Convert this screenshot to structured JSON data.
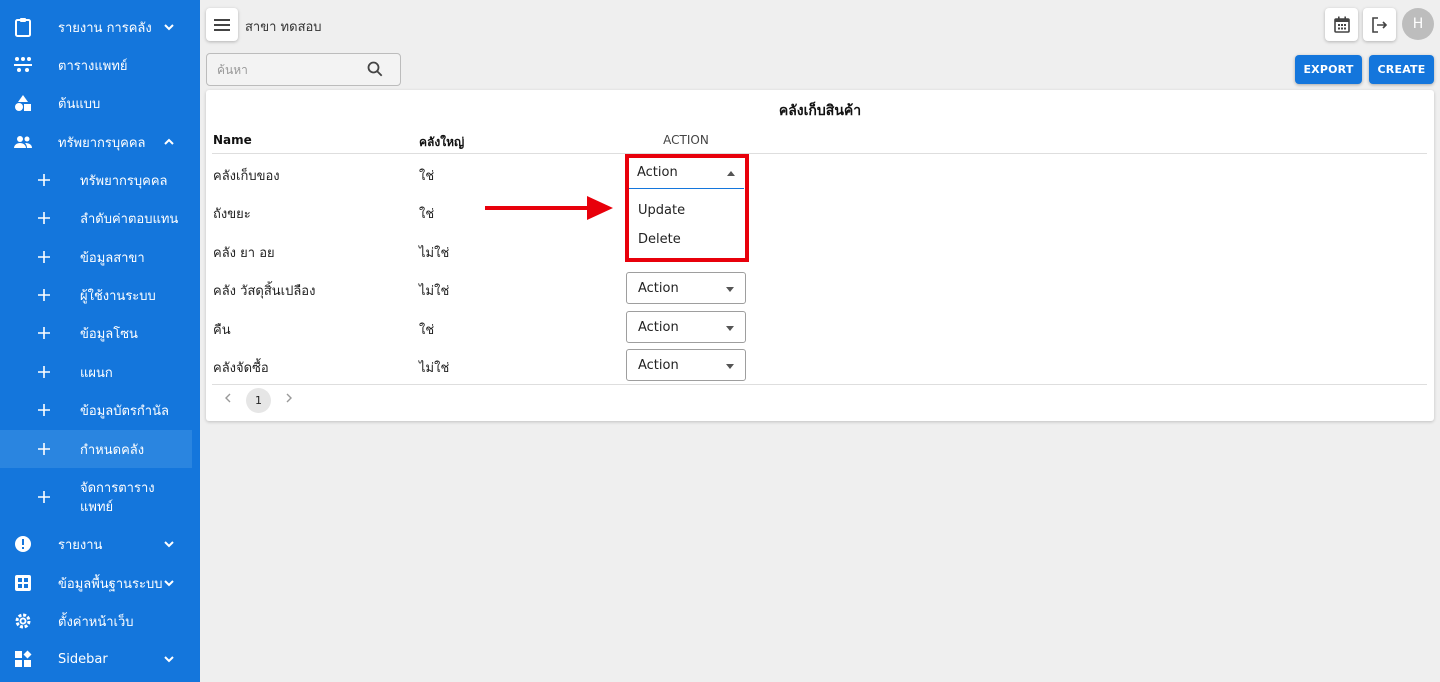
{
  "sidebar": {
    "items": [
      {
        "label": "รายงาน การคลัง",
        "icon": "clipboard-icon"
      },
      {
        "label": "ตารางแพทย์",
        "icon": "people-network-icon"
      },
      {
        "label": "ต้นแบบ",
        "icon": "shapes-icon"
      },
      {
        "label": "ทรัพยากรบุคคล",
        "icon": "group-icon"
      },
      {
        "label": "ทรัพยากรบุคคล",
        "icon": "plus-icon"
      },
      {
        "label": "ลำดับค่าตอบแทน",
        "icon": "plus-icon"
      },
      {
        "label": "ข้อมูลสาขา",
        "icon": "plus-icon"
      },
      {
        "label": "ผู้ใช้งานระบบ",
        "icon": "plus-icon"
      },
      {
        "label": "ข้อมูลโซน",
        "icon": "plus-icon"
      },
      {
        "label": "แผนก",
        "icon": "plus-icon"
      },
      {
        "label": "ข้อมูลบัตรกำนัล",
        "icon": "plus-icon"
      },
      {
        "label": "กำหนดคลัง",
        "icon": "plus-icon"
      },
      {
        "label_line1": "จัดการตาราง",
        "label_line2": "แพทย์",
        "icon": "plus-icon"
      },
      {
        "label": "รายงาน",
        "icon": "alert-circle-icon"
      },
      {
        "label": "ข้อมูลพื้นฐานระบบ",
        "icon": "grid-icon"
      },
      {
        "label": "ตั้งค่าหน้าเว็บ",
        "icon": "gear-icon"
      },
      {
        "label": "Sidebar",
        "icon": "widgets-icon"
      }
    ]
  },
  "header": {
    "branch": "สาขา ทดสอบ",
    "avatar_initial": "H"
  },
  "search": {
    "placeholder": "ค้นหา"
  },
  "buttons": {
    "export": "EXPORT",
    "create": "CREATE"
  },
  "table": {
    "title": "คลังเก็บสินค้า",
    "columns": [
      "Name",
      "คลังใหญ่",
      "ACTION"
    ],
    "rows": [
      {
        "name": "คลังเก็บของ",
        "main": "ใช่",
        "action": "Action"
      },
      {
        "name": "ถังขยะ",
        "main": "ใช่",
        "action": "Action"
      },
      {
        "name": "คลัง ยา อย",
        "main": "ไม่ใช่",
        "action": "Action"
      },
      {
        "name": "คลัง วัสดุสิ้นเปลือง",
        "main": "ไม่ใช่",
        "action": "Action"
      },
      {
        "name": "คืน",
        "main": "ใช่",
        "action": "Action"
      },
      {
        "name": "คลังจัดซื้อ",
        "main": "ไม่ใช่",
        "action": "Action"
      }
    ],
    "dropdown_options": [
      "Update",
      "Delete"
    ]
  },
  "pagination": {
    "current_page": "1"
  },
  "colors": {
    "brand": "#1476dc",
    "highlight": "#e8000b"
  }
}
